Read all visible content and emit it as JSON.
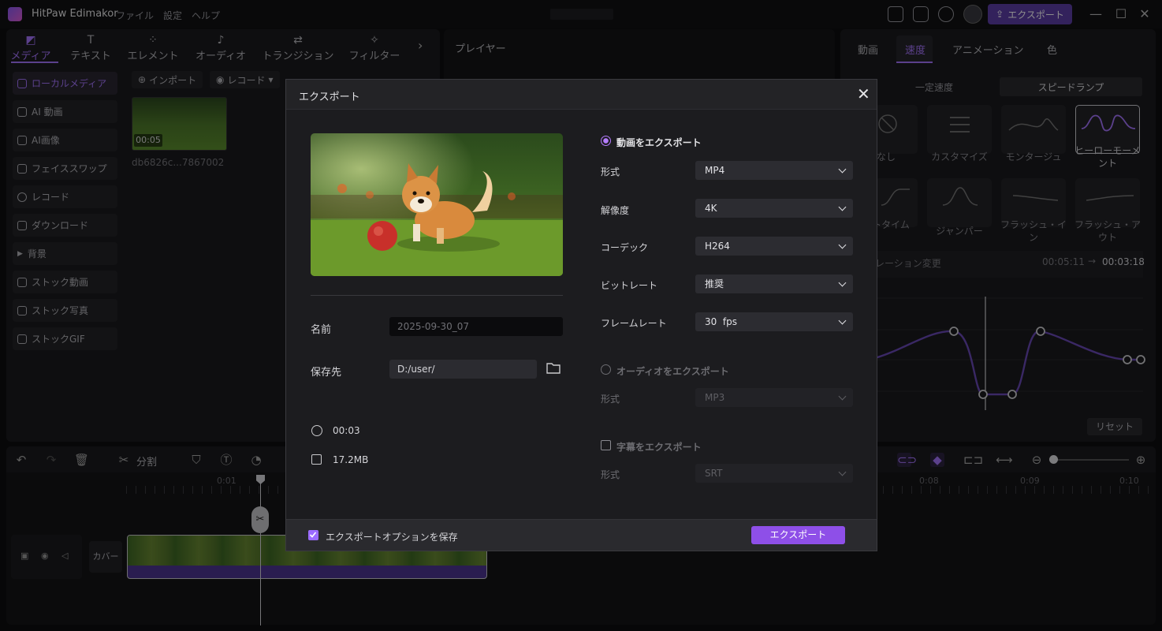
{
  "app": {
    "name": "HitPaw Edimakor",
    "menu": [
      "ファイル",
      "設定",
      "ヘルプ"
    ],
    "export_label": "エクスポート"
  },
  "left_panel": {
    "tabs": [
      {
        "label": "メディア",
        "icon": "media-icon",
        "active": true
      },
      {
        "label": "テキスト",
        "icon": "text-icon"
      },
      {
        "label": "エレメント",
        "icon": "element-icon"
      },
      {
        "label": "オーディオ",
        "icon": "audio-icon"
      },
      {
        "label": "トランジション",
        "icon": "transition-icon"
      },
      {
        "label": "フィルター",
        "icon": "filter-icon"
      }
    ],
    "sidebar": [
      {
        "label": "ローカルメディア",
        "active": true
      },
      {
        "label": "AI 動画"
      },
      {
        "label": "AI画像"
      },
      {
        "label": "フェイススワップ"
      },
      {
        "label": "レコード"
      },
      {
        "label": "ダウンロード"
      },
      {
        "label": "背景"
      },
      {
        "label": "ストック動画"
      },
      {
        "label": "ストック写真"
      },
      {
        "label": "ストックGIF"
      }
    ],
    "import_label": "インポート",
    "record_label": "レコード",
    "media_item": {
      "duration": "00:05",
      "name": "db6826c...7867002"
    }
  },
  "player": {
    "title": "プレイヤー"
  },
  "right_panel": {
    "tabs": [
      "動画",
      "速度",
      "アニメーション",
      "色"
    ],
    "active_tab": "速度",
    "segments": [
      "一定速度",
      "スピードランプ"
    ],
    "presets_row1": [
      "なし",
      "カスタマイズ",
      "モンタージュ",
      "ヒーローモーメント"
    ],
    "presets_row2": [
      "ットタイム",
      "ジャンパー",
      "フラッシュ・イン",
      "フラッシュ・アウト"
    ],
    "duration_label": "レーション変更",
    "duration_from": "00:05:11",
    "duration_arrow": "→",
    "duration_to": "00:03:18",
    "reset_label": "リセット"
  },
  "timeline": {
    "split_label": "分割",
    "ruler": [
      "0:01",
      "0:08",
      "0:09",
      "0:10"
    ],
    "cover_label": "カバー"
  },
  "dialog": {
    "title": "エクスポート",
    "name_label": "名前",
    "name_value": "2025-09-30_07",
    "save_label": "保存先",
    "save_path": "D:/user/",
    "duration": "00:03",
    "size": "17.2MB",
    "video_export": {
      "label": "動画をエクスポート",
      "format_label": "形式",
      "format": "MP4",
      "resolution_label": "解像度",
      "resolution": "4K",
      "codec_label": "コーデック",
      "codec": "H264",
      "bitrate_label": "ビットレート",
      "bitrate": "推奨",
      "framerate_label": "フレームレート",
      "framerate": "30  fps"
    },
    "audio_export": {
      "label": "オーディオをエクスポート",
      "format_label": "形式",
      "format": "MP3"
    },
    "subtitle_export": {
      "label": "字幕をエクスポート",
      "format_label": "形式",
      "format": "SRT"
    },
    "keep_options_label": "エクスポートオプションを保存",
    "export_button": "エクスポート"
  }
}
